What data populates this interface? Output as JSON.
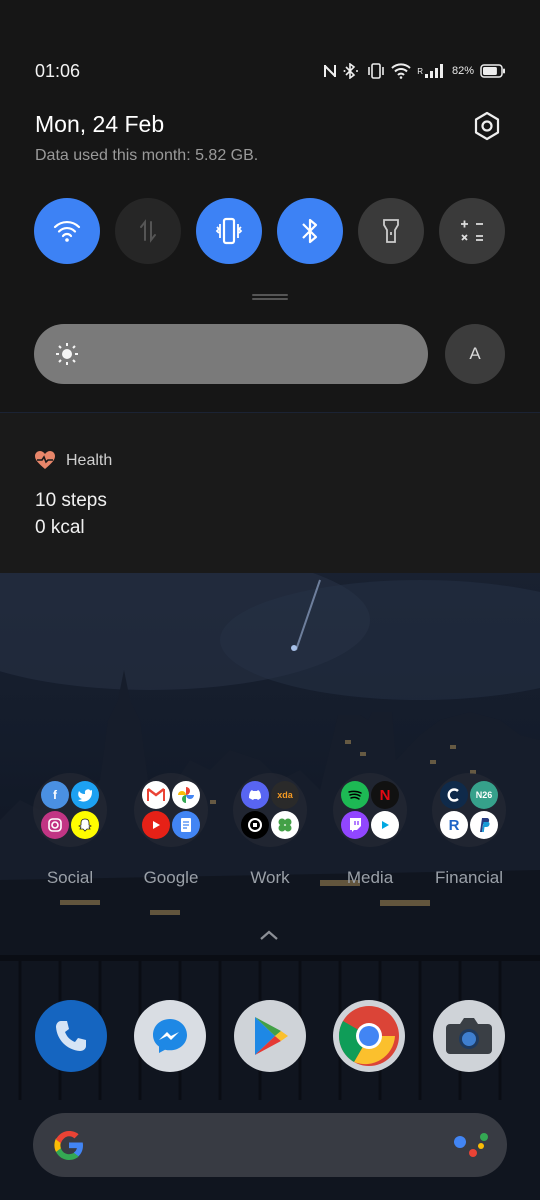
{
  "status_bar": {
    "time": "01:06",
    "battery_percent": "82%",
    "battery_level": 0.82,
    "signal_roaming": "R",
    "icons": [
      "nfc-icon",
      "bluetooth-icon",
      "vibrate-icon",
      "wifi-icon",
      "signal-icon",
      "battery-icon"
    ]
  },
  "header": {
    "date": "Mon, 24 Feb",
    "data_used": "Data used this month: 5.82 GB."
  },
  "quick_settings": {
    "tiles": [
      {
        "name": "wifi",
        "state": "on"
      },
      {
        "name": "mobile-data",
        "state": "off"
      },
      {
        "name": "vibrate",
        "state": "on"
      },
      {
        "name": "bluetooth",
        "state": "on"
      },
      {
        "name": "flashlight",
        "state": "off"
      },
      {
        "name": "calculator",
        "state": "off"
      }
    ],
    "accent_color": "#3d82f5",
    "brightness_level": 0,
    "auto_brightness_label": "A"
  },
  "health": {
    "title": "Health",
    "steps": "10 steps",
    "kcal": "0 kcal",
    "icon_color": "#e8866a"
  },
  "home": {
    "folders": [
      {
        "label": "Social",
        "apps": [
          "f",
          "twitter",
          "instagram",
          "snapchat"
        ]
      },
      {
        "label": "Google",
        "apps": [
          "gmail",
          "photos",
          "youtube",
          "docs"
        ]
      },
      {
        "label": "Work",
        "apps": [
          "discord",
          "xda",
          "uber",
          "clover"
        ]
      },
      {
        "label": "Media",
        "apps": [
          "spotify",
          "netflix",
          "twitch",
          "prime"
        ]
      },
      {
        "label": "Financial",
        "apps": [
          "c",
          "N26",
          "R",
          "paypal"
        ]
      }
    ],
    "dock": [
      "phone",
      "messenger",
      "play-store",
      "chrome",
      "camera"
    ]
  }
}
